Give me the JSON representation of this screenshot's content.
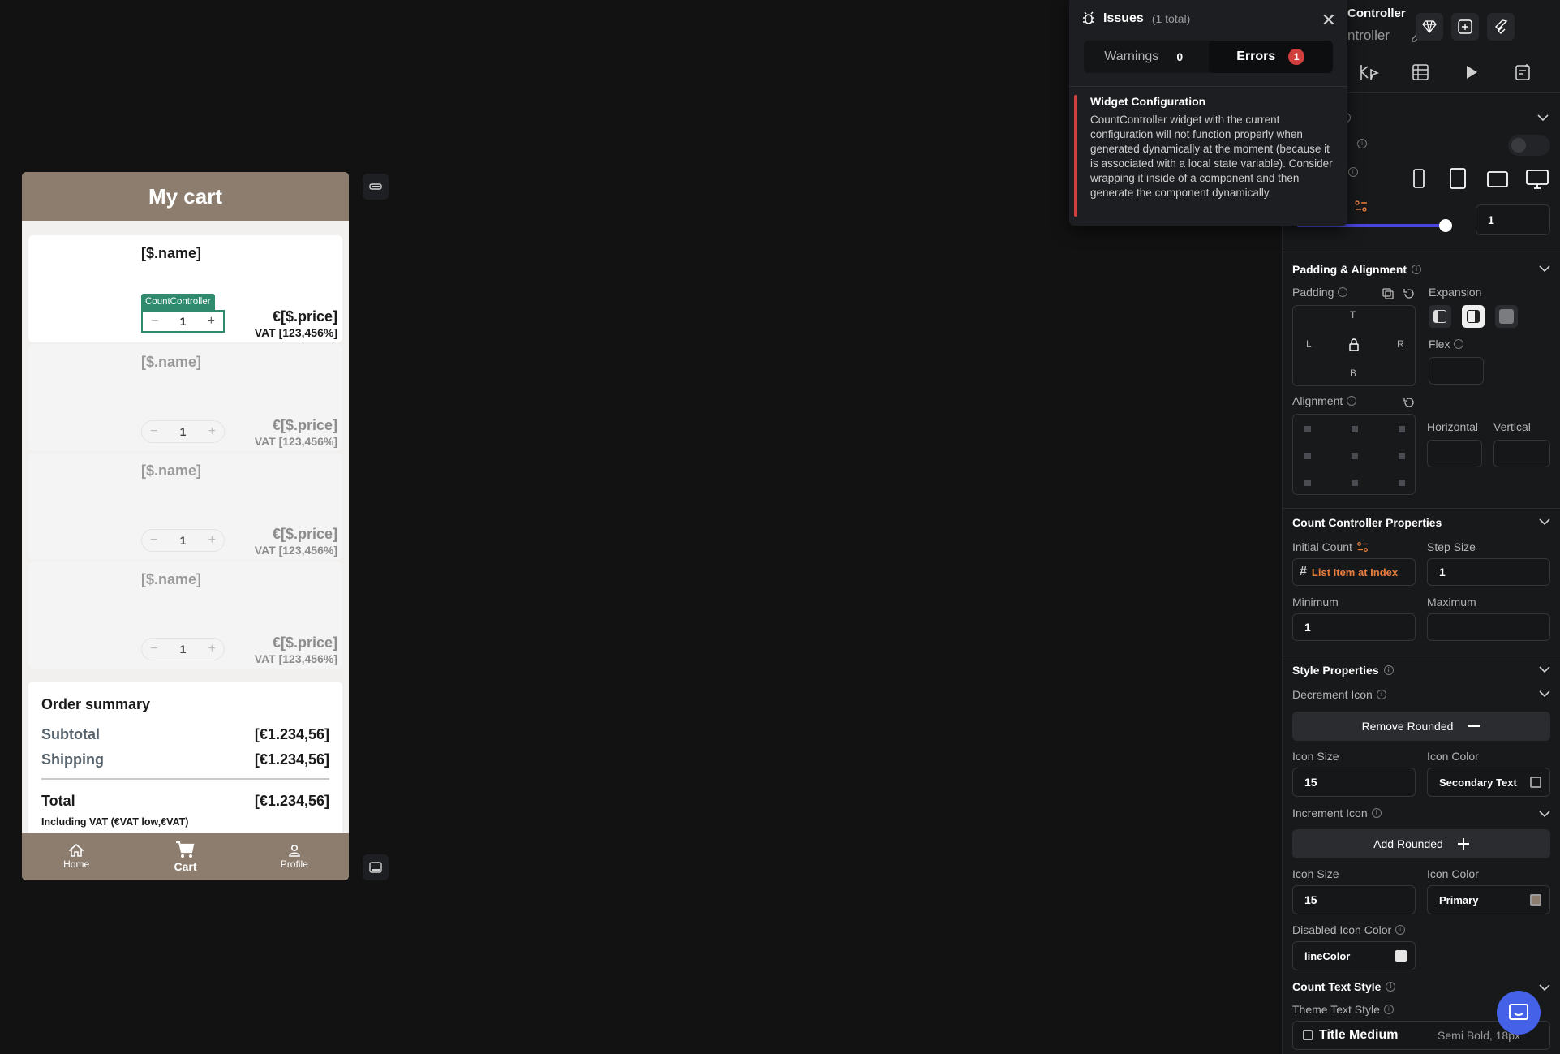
{
  "phone": {
    "appbar_title": "My cart",
    "items": [
      {
        "name": "[$.name]",
        "count": "1",
        "price": "€[$.price]",
        "vat": "VAT [123,456%]",
        "selected": true
      },
      {
        "name": "[$.name]",
        "count": "1",
        "price": "€[$.price]",
        "vat": "VAT [123,456%]"
      },
      {
        "name": "[$.name]",
        "count": "1",
        "price": "€[$.price]",
        "vat": "VAT [123,456%]"
      },
      {
        "name": "[$.name]",
        "count": "1",
        "price": "€[$.price]",
        "vat": "VAT [123,456%]"
      }
    ],
    "counter_tag": "CountController",
    "decrement_glyph": "−",
    "increment_glyph": "+",
    "summary": {
      "title": "Order summary",
      "subtotal_label": "Subtotal",
      "subtotal_value": "[€1.234,56]",
      "shipping_label": "Shipping",
      "shipping_value": "[€1.234,56]",
      "total_label": "Total",
      "total_value": "[€1.234,56]",
      "vat_note": "Including VAT (€VAT low,€VAT)"
    },
    "nav": [
      {
        "label": "Home",
        "icon": "home-icon"
      },
      {
        "label": "Cart",
        "icon": "cart-icon",
        "active": true
      },
      {
        "label": "Profile",
        "icon": "profile-icon"
      }
    ]
  },
  "issues": {
    "title": "Issues",
    "count_text": "(1 total)",
    "close_glyph": "✕",
    "tabs": {
      "warnings_label": "Warnings",
      "warnings_count": "0",
      "errors_label": "Errors",
      "errors_count": "1"
    },
    "card_title": "Widget Configuration",
    "card_body": "CountController widget with the current configuration will not function properly when generated dynamically at the moment (because it is associated with a local state variable). Consider wrapping it inside of a component and then generate the component dynamically."
  },
  "panel": {
    "widget_title": "Controller",
    "widget_subtitle": "ntroller",
    "row_label_1": "e",
    "slider_value": "1",
    "padding_alignment_title": "Padding & Alignment",
    "padding_label": "Padding",
    "expansion_label": "Expansion",
    "pad_t": "T",
    "pad_l": "L",
    "pad_r": "R",
    "pad_b": "B",
    "flex_label": "Flex",
    "alignment_label": "Alignment",
    "horizontal_label": "Horizontal",
    "vertical_label": "Vertical",
    "ccp_title": "Count Controller Properties",
    "initial_count_label": "Initial Count",
    "initial_count_value": "List Item at Index",
    "step_size_label": "Step Size",
    "step_size_value": "1",
    "minimum_label": "Minimum",
    "minimum_value": "1",
    "maximum_label": "Maximum",
    "maximum_value": "",
    "style_title": "Style Properties",
    "decrement_icon_label": "Decrement Icon",
    "decrement_icon_value": "Remove Rounded",
    "icon_size_label": "Icon Size",
    "icon_color_label": "Icon Color",
    "dec_icon_size": "15",
    "dec_icon_color": "Secondary Text",
    "increment_icon_label": "Increment Icon",
    "increment_icon_value": "Add Rounded",
    "inc_icon_size": "15",
    "inc_icon_color": "Primary",
    "disabled_color_label": "Disabled Icon Color",
    "disabled_color_value": "lineColor",
    "count_text_style_label": "Count Text Style",
    "theme_text_style_label": "Theme Text Style",
    "theme_text_style_value": "Title Medium",
    "theme_text_style_meta": "Semi Bold, 18px"
  },
  "colors": {
    "appbar": "#8c7d6e",
    "selection": "#2f8a6e",
    "error": "#d13f3f",
    "accent": "#e87d3e",
    "slider": "#4a45e0",
    "chat": "#4461e8"
  }
}
